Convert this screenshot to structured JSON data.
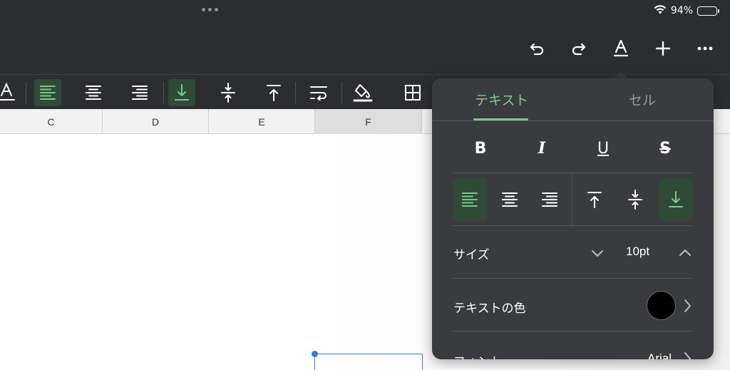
{
  "status_bar": {
    "battery_text": "94%",
    "battery_level": 0.94
  },
  "columns": [
    {
      "label": "C"
    },
    {
      "label": "D"
    },
    {
      "label": "E"
    },
    {
      "label": "F"
    }
  ],
  "popover": {
    "tabs": {
      "text": "テキスト",
      "cell": "セル",
      "active": "text"
    },
    "style_buttons": {
      "bold": "B",
      "italic": "I",
      "underline": "U",
      "strikethrough": "S"
    },
    "size": {
      "label": "サイズ",
      "value": "10pt"
    },
    "text_color": {
      "label": "テキストの色",
      "color": "#000000"
    },
    "font": {
      "label": "フォント",
      "value": "Arial"
    }
  },
  "colors": {
    "accent_green": "#7dc88e",
    "active_bg": "#2f4a36",
    "toolbar_bg": "#2c2d30",
    "popover_bg": "#3a3b3f",
    "selection_blue": "#3a7bd5"
  }
}
